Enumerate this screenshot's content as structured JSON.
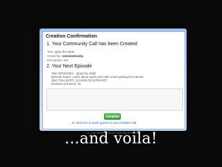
{
  "panel": {
    "title": "Creation Confirmation"
  },
  "section1": {
    "heading": "1. Your Community Call has been Created",
    "title_label": "Title:",
    "title_value": "Ignite the Web!",
    "hosted_label": "Hosted by:",
    "hosted_value": "connieckrosby",
    "desc_label": "Description:",
    "desc_value": "n/a"
  },
  "section2": {
    "heading": "2. Your Next Episode",
    "title_line": "Title: EPISODE1 - Ignite the Web!",
    "notes_line": "Episode Notes: Learn about audio and video tools igniting the internet.",
    "start_line": "Start Time (EDT): 11/14/08 03:10 PM EST",
    "duration_line": "Duration (minutes): 15"
  },
  "actions": {
    "complete_label": "Complete",
    "invite_prefix": "...or ",
    "invite_link": "click here to invite guests to your Unlisted Call."
  },
  "footer": {
    "faint_text": "\"...is only visible to people with link to this call.\"",
    "caption": "...and voila!"
  }
}
